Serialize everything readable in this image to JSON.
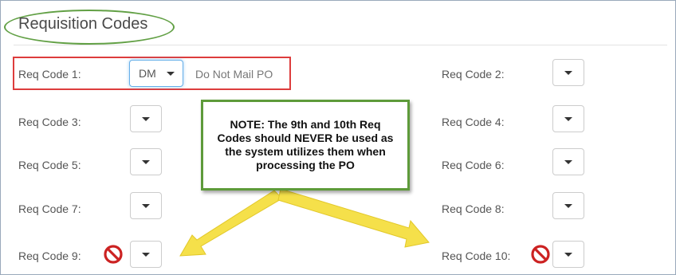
{
  "section": {
    "title": "Requisition Codes"
  },
  "req_codes": [
    {
      "label": "Req Code 1:",
      "value": "DM",
      "description": "Do Not Mail PO"
    },
    {
      "label": "Req Code 2:",
      "value": ""
    },
    {
      "label": "Req Code 3:",
      "value": ""
    },
    {
      "label": "Req Code 4:",
      "value": ""
    },
    {
      "label": "Req Code 5:",
      "value": ""
    },
    {
      "label": "Req Code 6:",
      "value": ""
    },
    {
      "label": "Req Code 7:",
      "value": ""
    },
    {
      "label": "Req Code 8:",
      "value": ""
    },
    {
      "label": "Req Code 9:",
      "value": ""
    },
    {
      "label": "Req Code 10:",
      "value": ""
    }
  ],
  "note": {
    "text": "NOTE: The 9th and 10th Req Codes should NEVER be used as the system utilizes them when processing the PO"
  },
  "colors": {
    "ellipse": "#62a045",
    "highlight_box": "#dd3d3d",
    "note_border": "#5e9b3a",
    "arrows": "#f5e04a",
    "prohibited_icon": "#cc2222"
  },
  "icons": {
    "dropdown": "caret-down-icon",
    "prohibited": "prohibited-icon"
  }
}
